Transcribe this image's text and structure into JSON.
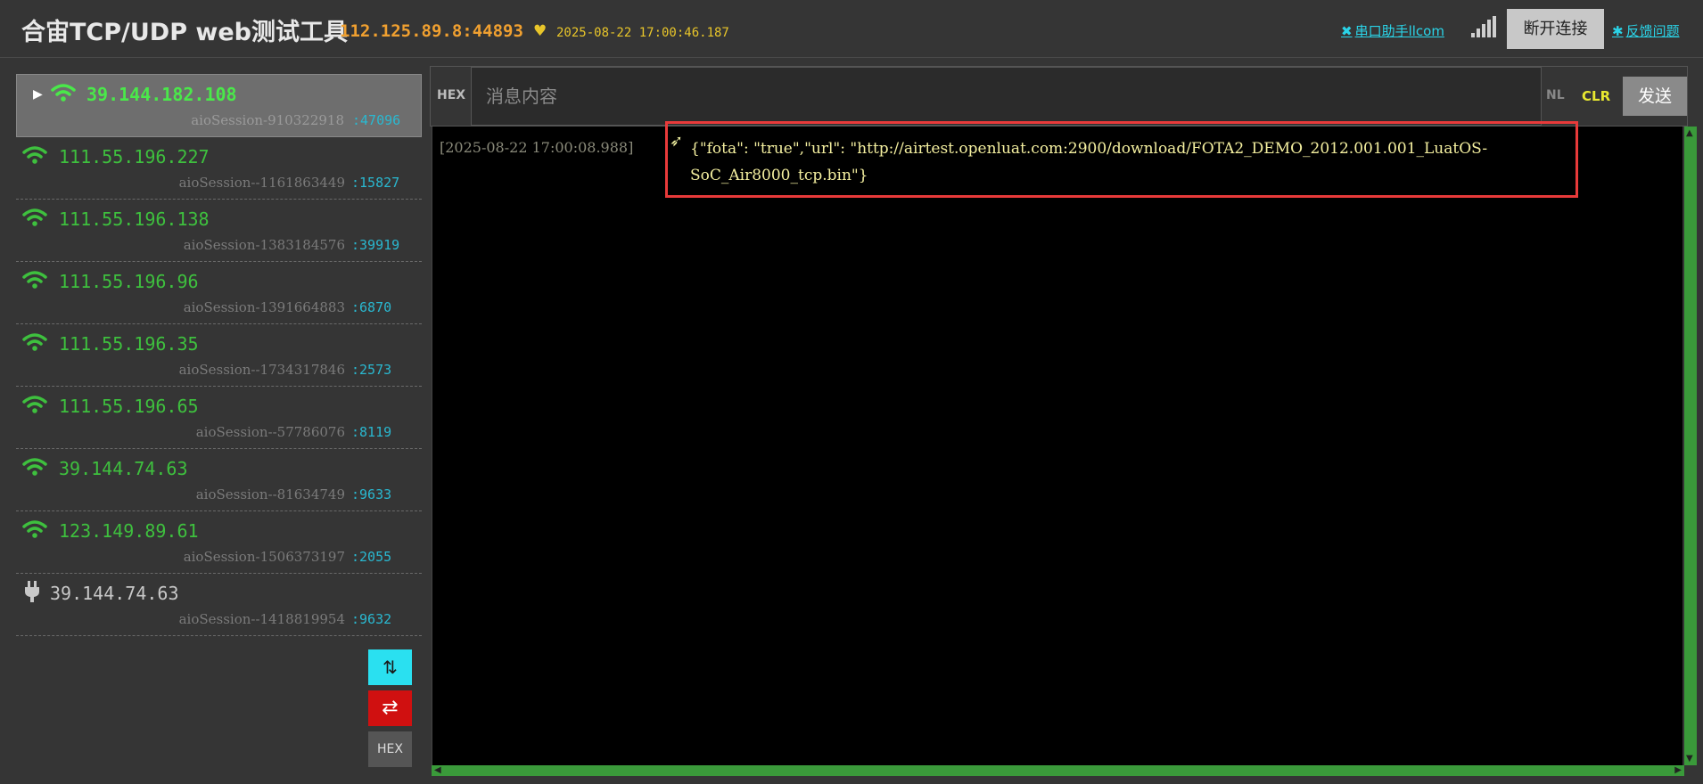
{
  "header": {
    "title": "合宙TCP/UDP web测试工具",
    "server_addr": "112.125.89.8:44893",
    "server_time": "2025-08-22 17:00:46.187",
    "serial_link": "串口助手llcom",
    "disconnect_label": "断开连接",
    "feedback_link": "反馈问题"
  },
  "sessions": [
    {
      "ip": "39.144.182.108",
      "sid": "aioSession-910322918",
      "port": ":47096",
      "status": "online",
      "active": true
    },
    {
      "ip": "111.55.196.227",
      "sid": "aioSession--1161863449",
      "port": ":15827",
      "status": "online"
    },
    {
      "ip": "111.55.196.138",
      "sid": "aioSession-1383184576",
      "port": ":39919",
      "status": "online"
    },
    {
      "ip": "111.55.196.96",
      "sid": "aioSession-1391664883",
      "port": ":6870",
      "status": "online"
    },
    {
      "ip": "111.55.196.35",
      "sid": "aioSession--1734317846",
      "port": ":2573",
      "status": "online"
    },
    {
      "ip": "111.55.196.65",
      "sid": "aioSession--57786076",
      "port": ":8119",
      "status": "online"
    },
    {
      "ip": "39.144.74.63",
      "sid": "aioSession--81634749",
      "port": ":9633",
      "status": "online"
    },
    {
      "ip": "123.149.89.61",
      "sid": "aioSession-1506373197",
      "port": ":2055",
      "status": "online"
    },
    {
      "ip": "39.144.74.63",
      "sid": "aioSession--1418819954",
      "port": ":9632",
      "status": "offline"
    }
  ],
  "side_buttons": {
    "hex_label": "HEX"
  },
  "input": {
    "hex_label": "HEX",
    "placeholder": "消息内容",
    "nl_label": "NL",
    "clr_label": "CLR",
    "send_label": "发送"
  },
  "log": [
    {
      "time": "[2025-08-22 17:00:08.988]",
      "direction": "sent",
      "message": "{\"fota\": \"true\",\"url\": \"http://airtest.openluat.com:2900/download/FOTA2_DEMO_2012.001.001_LuatOS-SoC_Air8000_tcp.bin\"}"
    }
  ],
  "colors": {
    "accent_cyan": "#2ad4e8",
    "online_green": "#3ec03e",
    "warning_red": "#d01010",
    "server_orange": "#f0a030"
  }
}
